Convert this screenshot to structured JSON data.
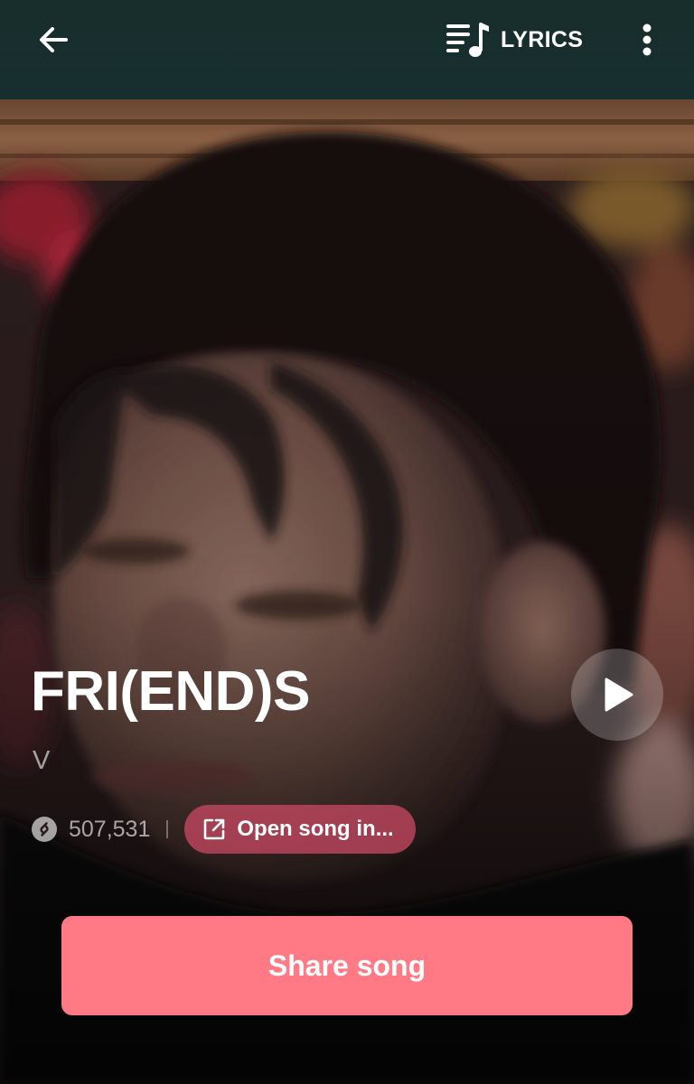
{
  "top_bar": {
    "back_icon": "arrow-left-icon",
    "lyrics_icon": "lyrics-note-icon",
    "lyrics_label": "LYRICS",
    "more_icon": "more-vertical-icon"
  },
  "song": {
    "title": "FRI(END)S",
    "artist": "V",
    "shazam_icon": "shazam-icon",
    "shazam_count": "507,531",
    "open_icon": "external-link-icon",
    "open_label": "Open song in...",
    "play_icon": "play-icon"
  },
  "actions": {
    "share_label": "Share song"
  },
  "colors": {
    "accent": "#ff7a85",
    "open_button_bg": "#c44860",
    "text_primary": "#ffffff"
  }
}
